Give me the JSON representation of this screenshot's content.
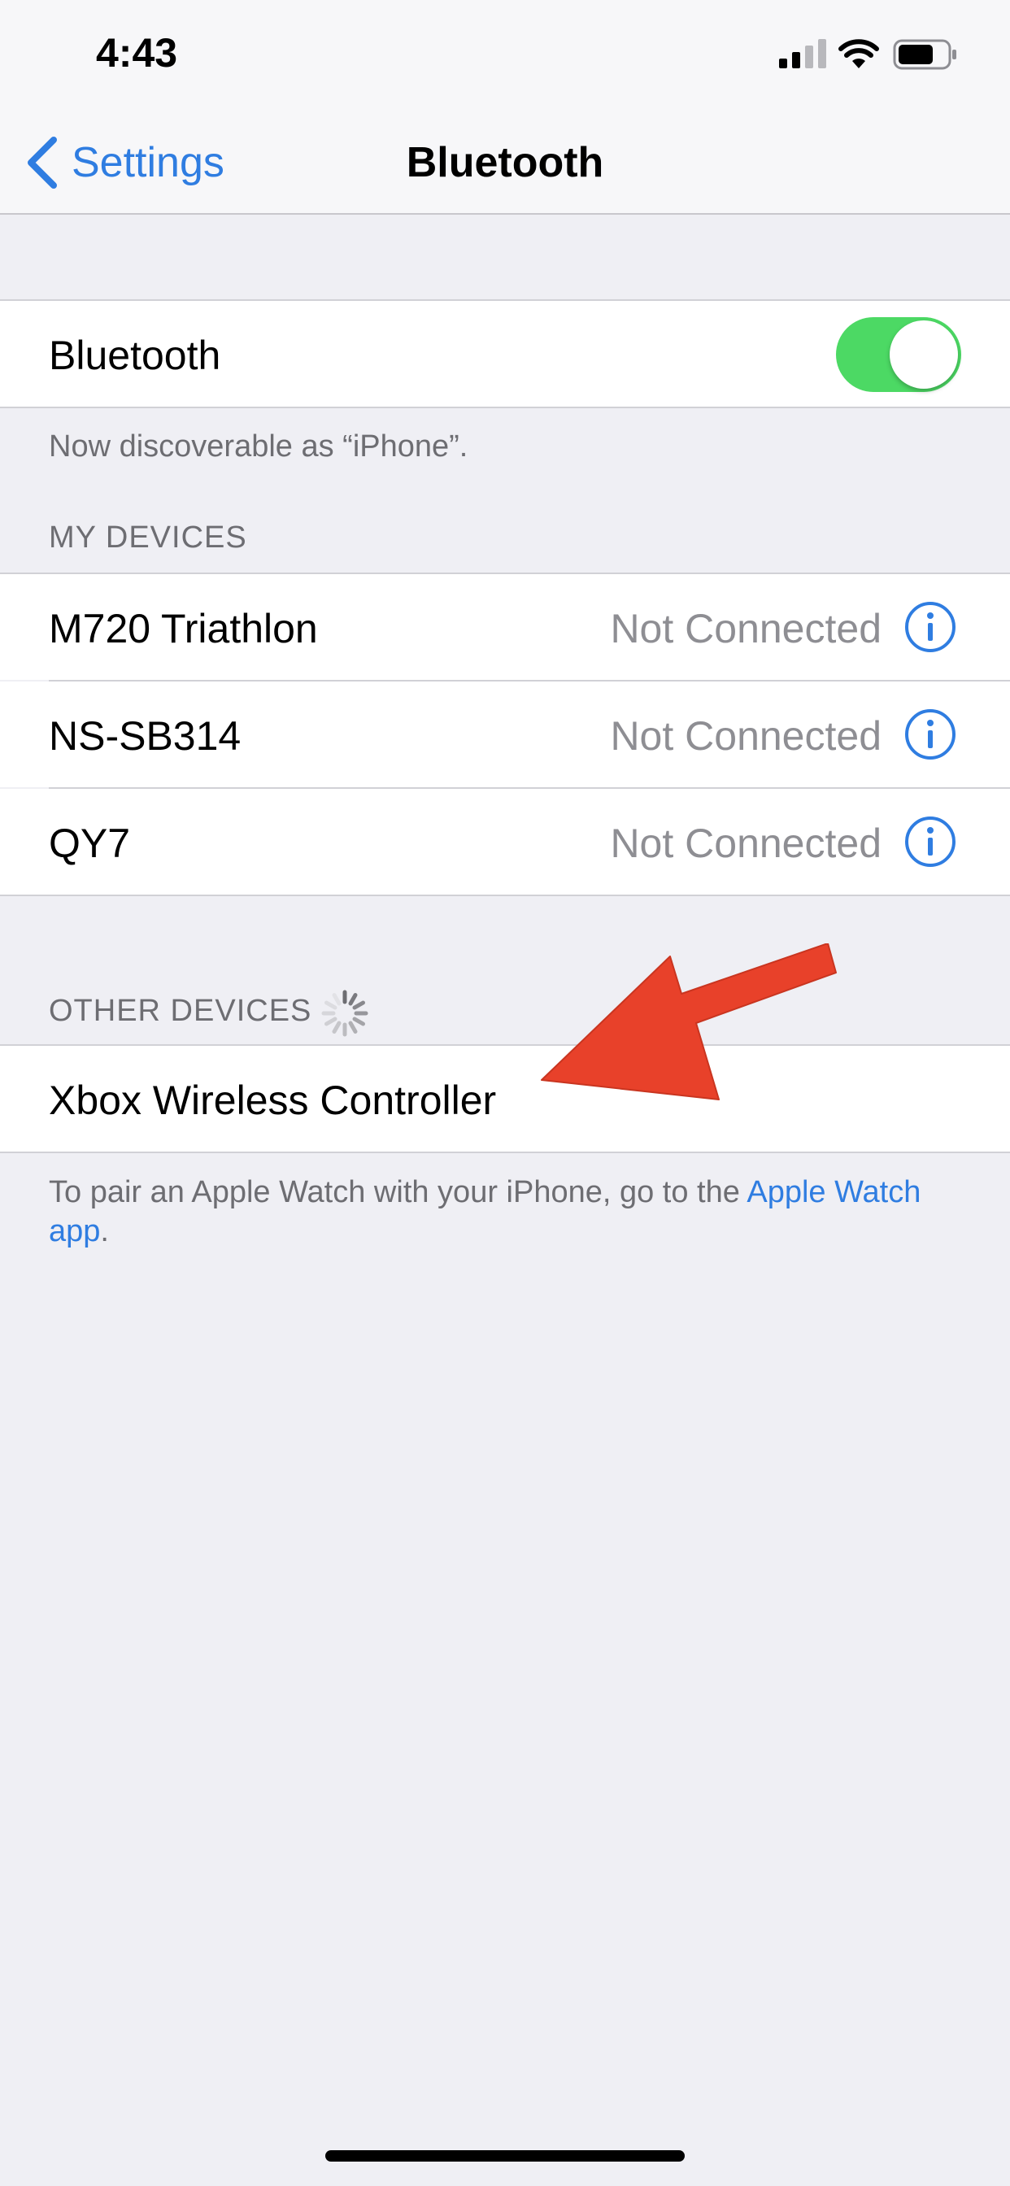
{
  "status_bar": {
    "time": "4:43"
  },
  "nav": {
    "back_label": "Settings",
    "title": "Bluetooth"
  },
  "bluetooth": {
    "label": "Bluetooth",
    "enabled": true,
    "discoverable_text": "Now discoverable as “iPhone”."
  },
  "my_devices": {
    "header": "MY DEVICES",
    "items": [
      {
        "name": "M720 Triathlon",
        "status": "Not Connected"
      },
      {
        "name": "NS-SB314",
        "status": "Not Connected"
      },
      {
        "name": "QY7",
        "status": "Not Connected"
      }
    ]
  },
  "other_devices": {
    "header": "OTHER DEVICES",
    "items": [
      {
        "name": "Xbox Wireless Controller"
      }
    ],
    "footer_prefix": "To pair an Apple Watch with your iPhone, go to the ",
    "footer_link": "Apple Watch app",
    "footer_suffix": "."
  },
  "colors": {
    "accent": "#2f7de1",
    "toggle_on": "#4cd964",
    "arrow": "#e8412a",
    "background": "#efeff4"
  },
  "icons": [
    "signal-icon",
    "wifi-icon",
    "battery-icon",
    "back-chevron-icon",
    "info-icon",
    "spinner-icon",
    "arrow-annotation"
  ]
}
